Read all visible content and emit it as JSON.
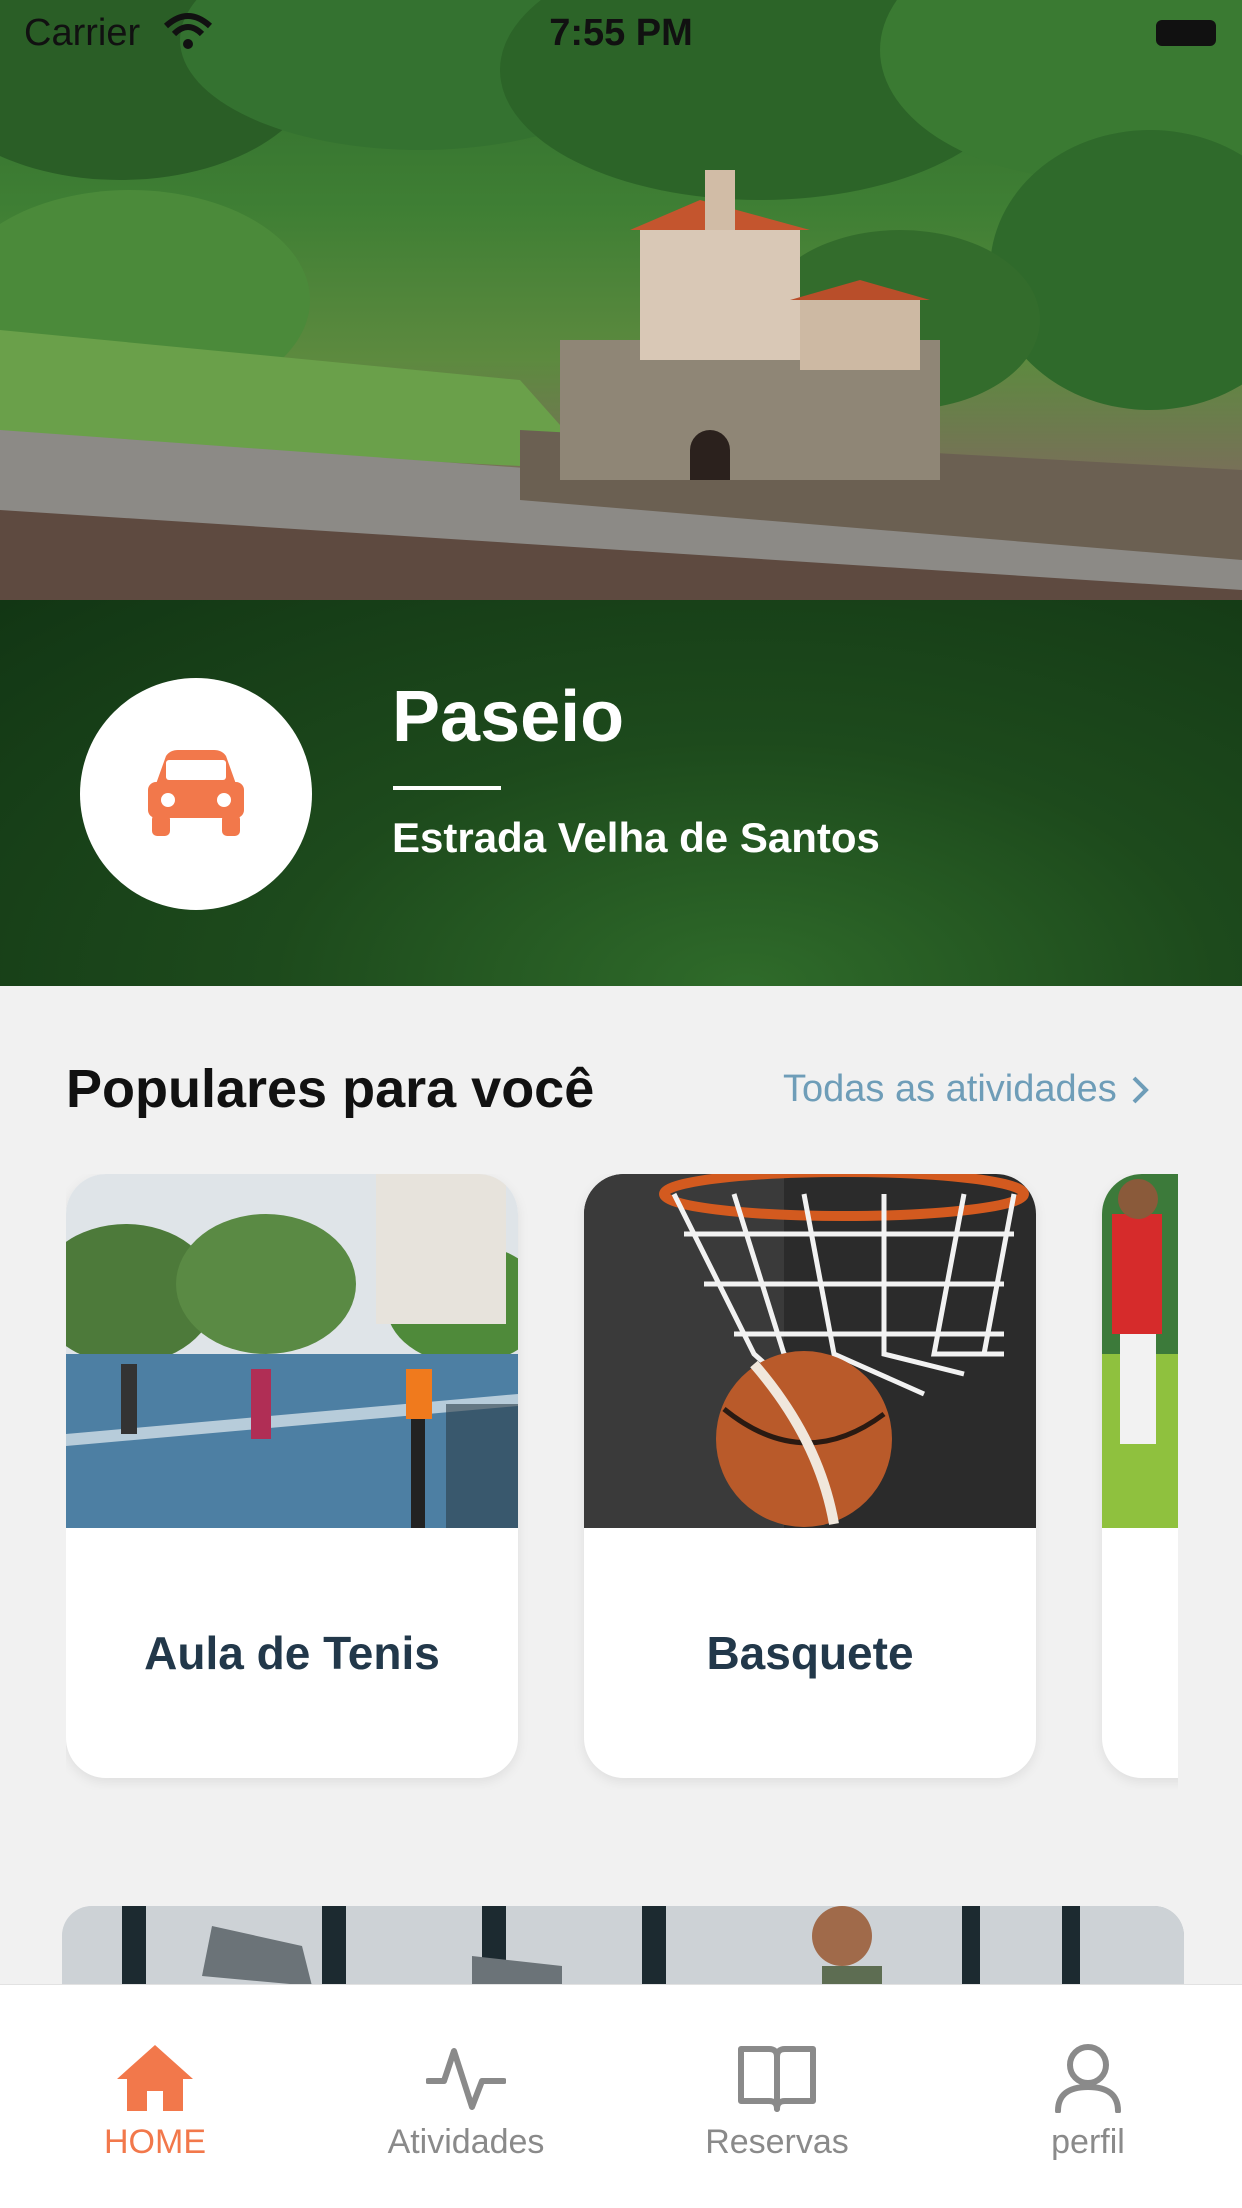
{
  "status_bar": {
    "carrier": "Carrier",
    "time": "7:55 PM"
  },
  "hero": {
    "image": "estrada-velha-de-santos-landscape"
  },
  "banner": {
    "icon": "car-icon",
    "title": "Paseio",
    "subtitle": "Estrada Velha de Santos",
    "accent_color": "#f2784b"
  },
  "popular": {
    "title": "Populares para você",
    "see_all_label": "Todas as atividades",
    "cards": [
      {
        "label": "Aula de Tenis",
        "image": "tennis-court-photo"
      },
      {
        "label": "Basquete",
        "image": "basketball-hoop-photo"
      },
      {
        "label": "",
        "image": "soccer-photo"
      }
    ]
  },
  "promo": {
    "image": "gym-treadmill-photo"
  },
  "tab_bar": {
    "active_color": "#f2784b",
    "inactive_color": "#8a8a8a",
    "tabs": [
      {
        "label": "HOME",
        "icon": "home-icon",
        "active": true
      },
      {
        "label": "Atividades",
        "icon": "activity-icon",
        "active": false
      },
      {
        "label": "Reservas",
        "icon": "book-icon",
        "active": false
      },
      {
        "label": "perfil",
        "icon": "user-icon",
        "active": false
      }
    ]
  }
}
